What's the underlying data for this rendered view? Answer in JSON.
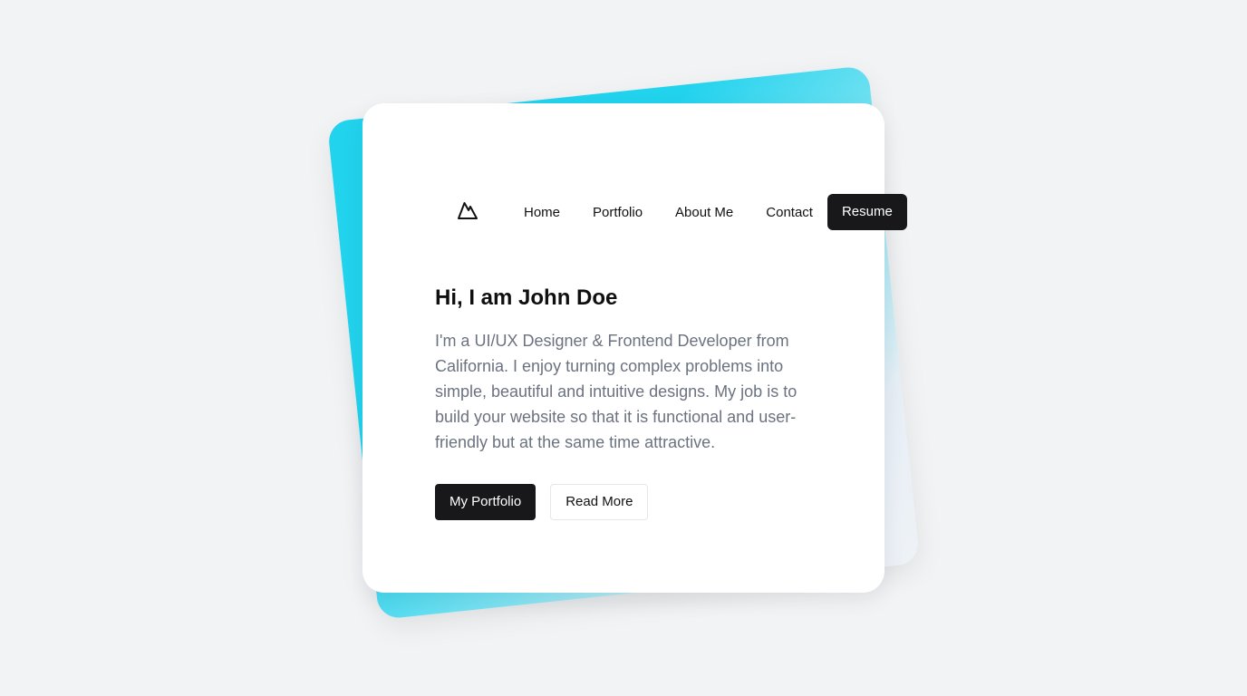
{
  "nav": {
    "logo_icon": "mountain-icon",
    "links": [
      {
        "label": "Home"
      },
      {
        "label": "Portfolio"
      },
      {
        "label": "About Me"
      },
      {
        "label": "Contact"
      }
    ],
    "resume_label": "Resume"
  },
  "hero": {
    "title": "Hi, I am John Doe",
    "description": "I'm a UI/UX Designer & Frontend Developer from California. I enjoy turning complex problems into simple, beautiful and intuitive designs. My job is to build your website so that it is functional and user-friendly but at the same time attractive."
  },
  "actions": {
    "primary_label": "My Portfolio",
    "secondary_label": "Read More"
  },
  "colors": {
    "accent": "#22d3ee",
    "dark": "#18181b",
    "background": "#f2f3f5",
    "text_muted": "#6b7280"
  }
}
